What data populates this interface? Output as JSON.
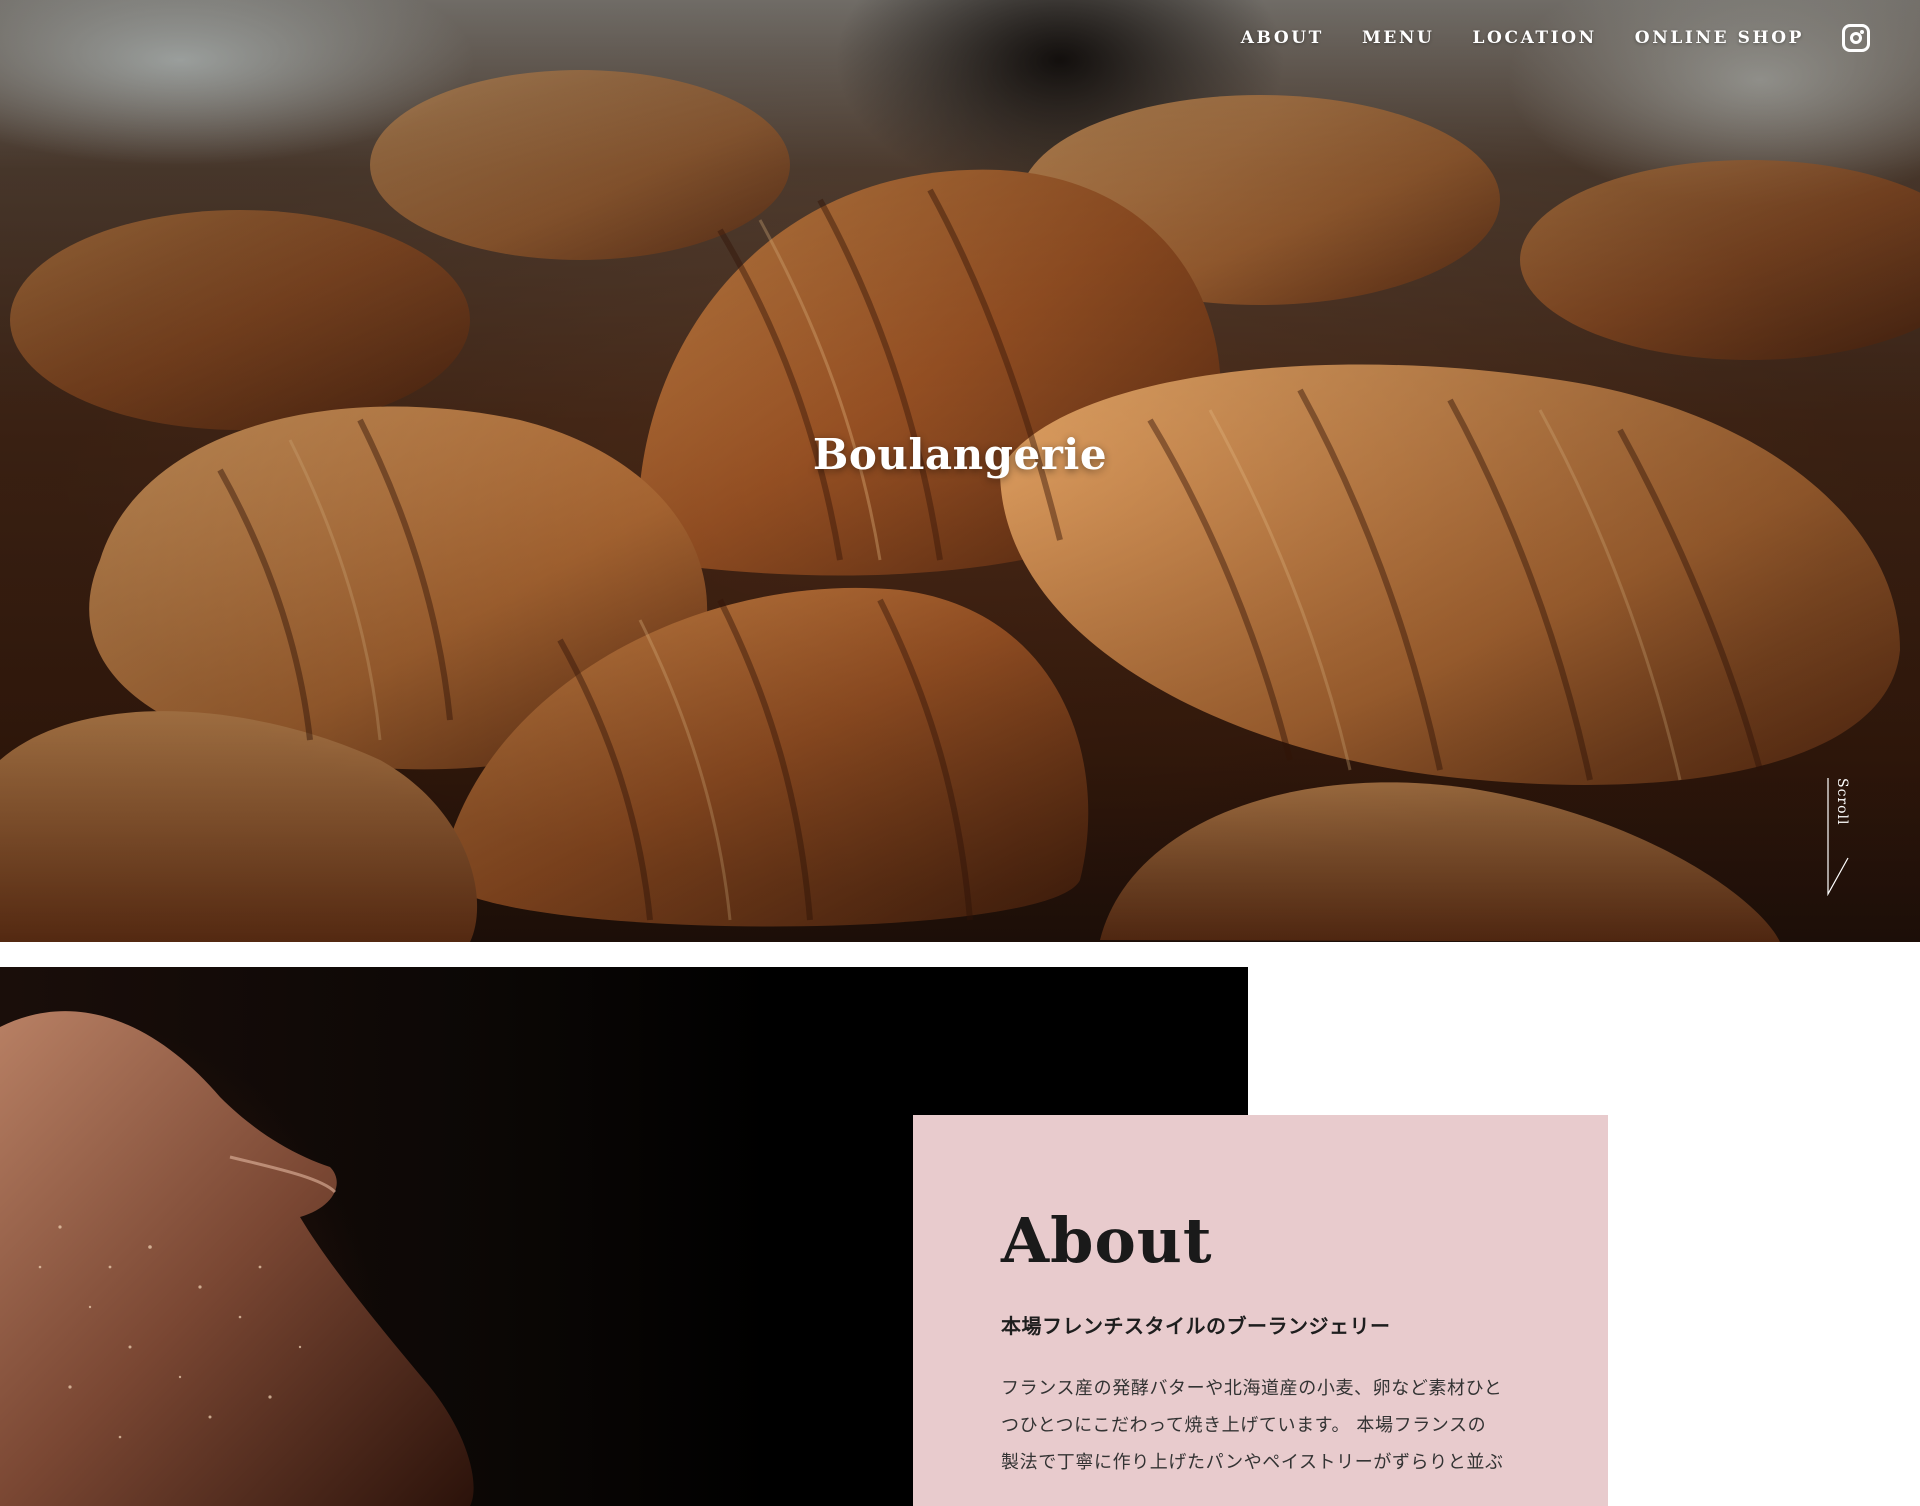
{
  "nav": {
    "items": [
      {
        "label": "ABOUT"
      },
      {
        "label": "MENU"
      },
      {
        "label": "LOCATION"
      },
      {
        "label": "ONLINE SHOP"
      }
    ],
    "social_icon": "instagram-icon"
  },
  "hero": {
    "title": "Boulangerie",
    "image": "croissants-photo",
    "scroll_label": "Scroll"
  },
  "about": {
    "image": "flour-hand-photo",
    "heading": "About",
    "subheading": "本場フレンチスタイルのブーランジェリー",
    "body_lines": [
      "フランス産の発酵バターや北海道産の小麦、卵など素材ひと",
      "つひとつにこだわって焼き上げています。 本場フランスの",
      "製法で丁寧に作り上げたパンやペイストリーがずらりと並ぶ"
    ]
  },
  "colors": {
    "about_card_bg": "#e8cbcd",
    "nav_text": "#ffffff",
    "heading_text": "#1a1a1a"
  }
}
